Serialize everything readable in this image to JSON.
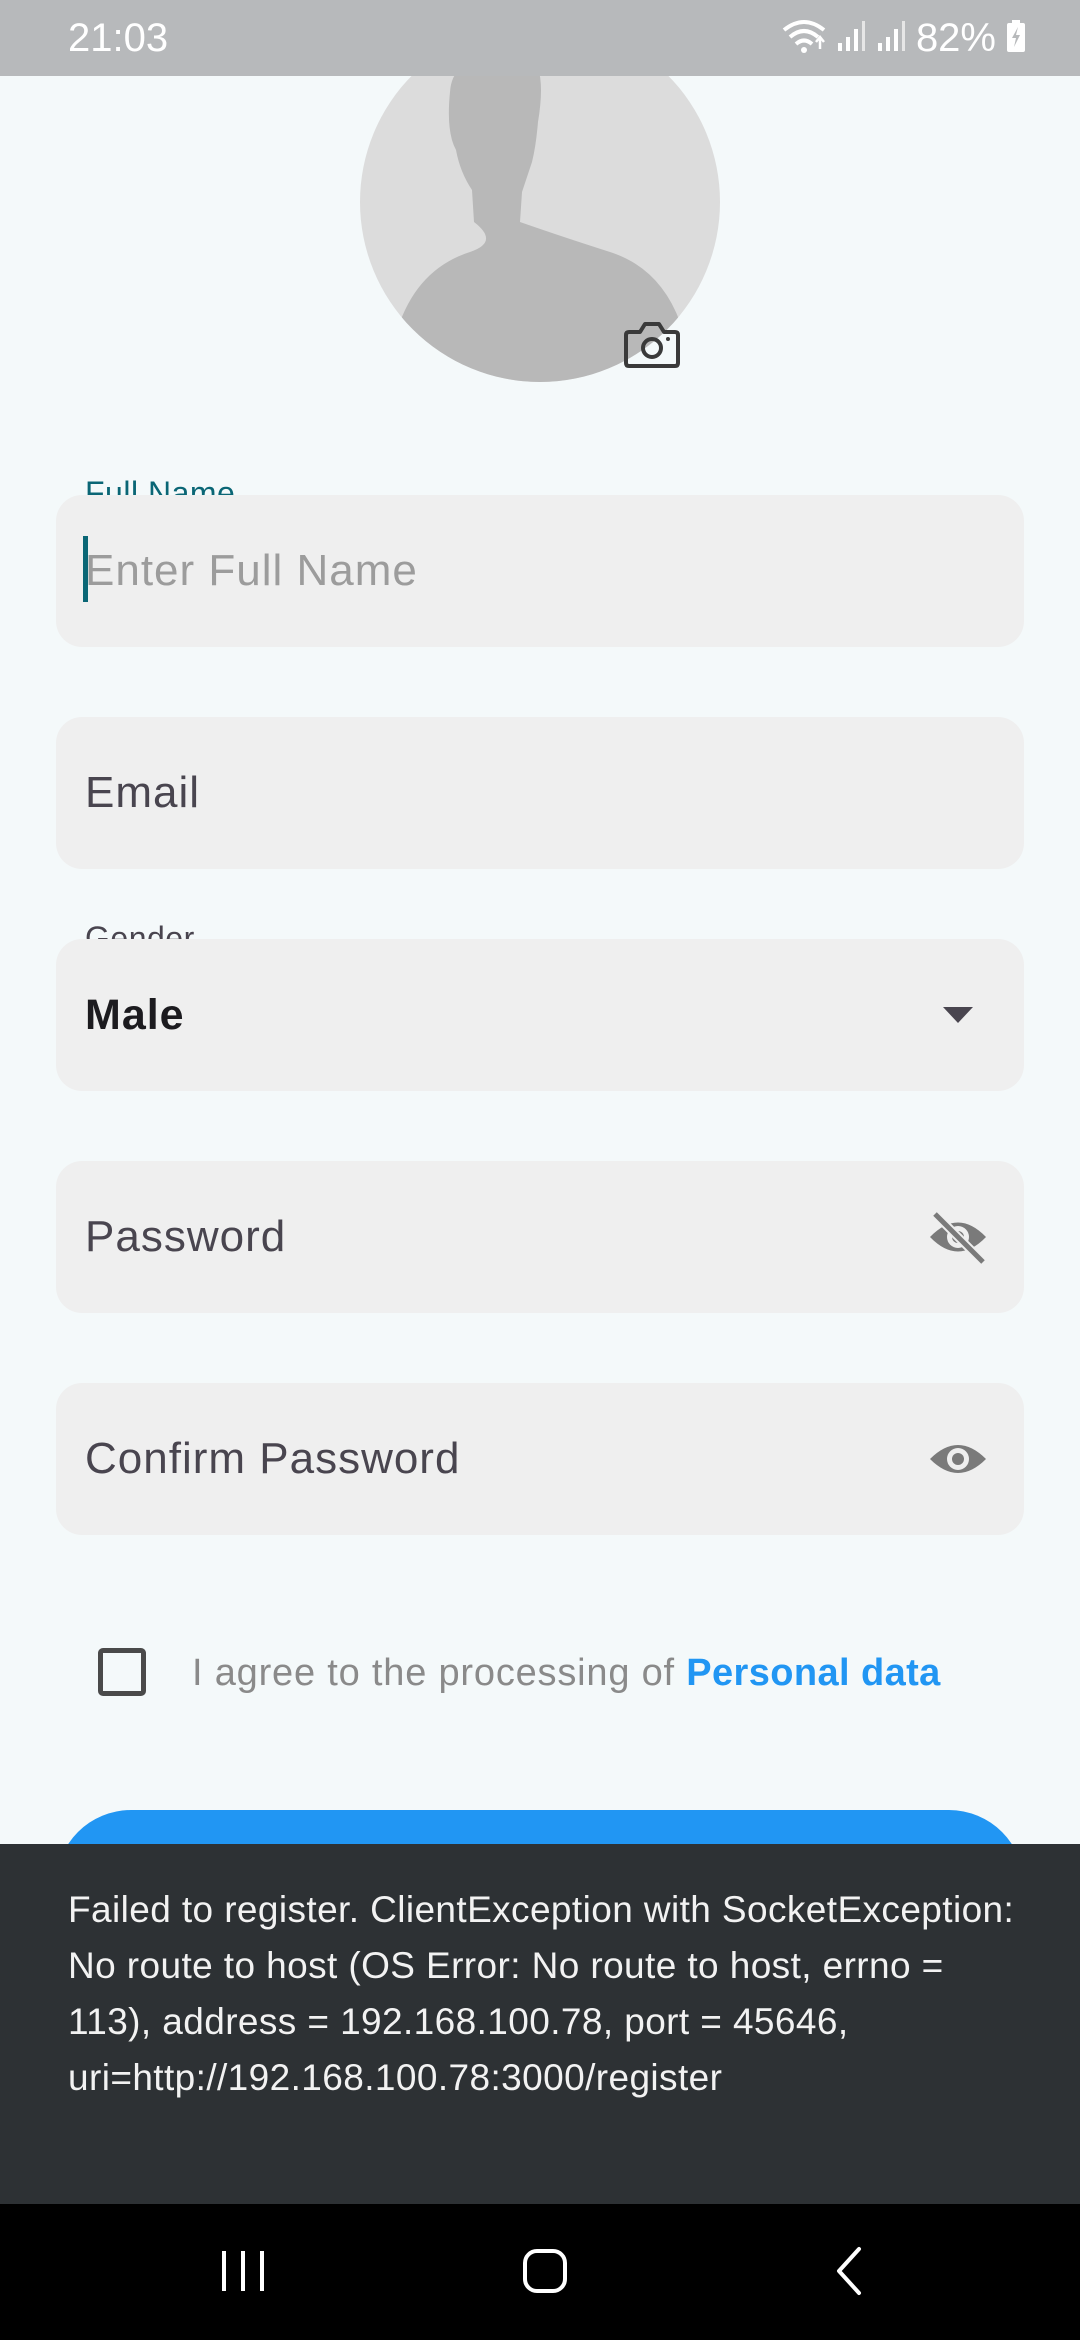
{
  "status_bar": {
    "time": "21:03",
    "battery": "82%",
    "icons": [
      "wifi-icon",
      "signal-icon",
      "signal-icon",
      "battery-charging-icon"
    ]
  },
  "avatar": {
    "icon": "person-silhouette-icon",
    "camera_icon": "camera-icon"
  },
  "form": {
    "full_name": {
      "label": "Full Name",
      "placeholder": "Enter Full Name",
      "label_color": "#0a6675"
    },
    "email": {
      "label": "Email"
    },
    "gender": {
      "label": "Gender",
      "value": "Male",
      "icon": "dropdown-arrow-icon"
    },
    "password": {
      "label": "Password",
      "icon": "visibility-off-icon"
    },
    "confirm_password": {
      "label": "Confirm Password",
      "icon": "visibility-icon"
    },
    "agreement": {
      "checked": false,
      "text": "I agree to the processing of ",
      "link": "Personal data",
      "link_color": "#2196f3"
    }
  },
  "primary_button": {
    "color": "#2196f3"
  },
  "snackbar": {
    "message": "Failed to register. ClientException with SocketException: No route to host (OS Error: No route to host, errno = 113), address = 192.168.100.78, port = 45646, uri=http://192.168.100.78:3000/register"
  },
  "nav_bar": {
    "buttons": [
      "recents-icon",
      "home-icon",
      "back-icon"
    ]
  }
}
